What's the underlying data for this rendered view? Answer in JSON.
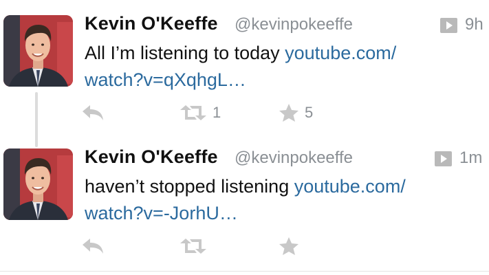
{
  "tweets": [
    {
      "author_name": "Kevin O'Keeffe",
      "handle": "@kevinpokeeffe",
      "time": "9h",
      "text_prefix": "All I’m listening to today ",
      "link_line1": "youtube.com/",
      "link_line2": "watch?v=qXqhgL…",
      "retweet_count": "1",
      "favorite_count": "5"
    },
    {
      "author_name": "Kevin O'Keeffe",
      "handle": "@kevinpokeeffe",
      "time": "1m",
      "text_prefix": "haven’t stopped listening ",
      "link_line1": "youtube.com/",
      "link_line2": "watch?v=-JorhU…",
      "retweet_count": "",
      "favorite_count": ""
    }
  ],
  "icons": {
    "reply": "reply-icon",
    "retweet": "retweet-icon",
    "favorite": "star-icon",
    "media": "play-media-icon"
  },
  "colors": {
    "link": "#2b6a9e",
    "meta_gray": "#8a8f94",
    "icon_gray": "#c8c8c8",
    "avatar_background": "#b63b3e"
  }
}
